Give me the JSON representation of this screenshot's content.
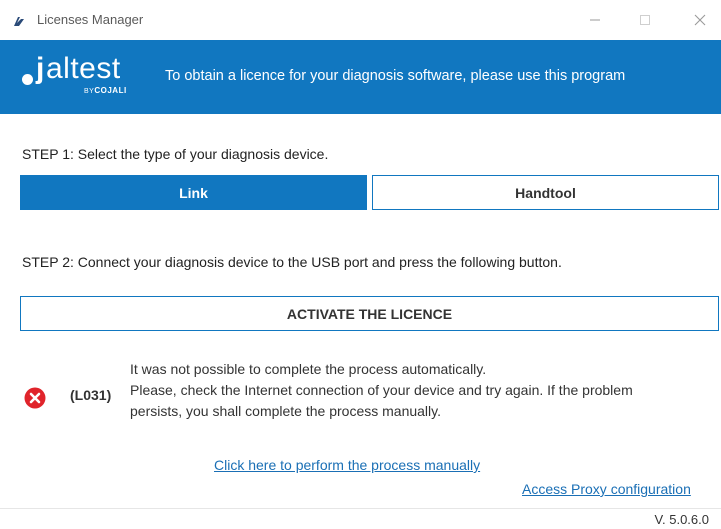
{
  "window": {
    "title": "Licenses Manager",
    "controls": {
      "minimize_icon": "minimize-icon",
      "maximize_icon": "maximize-icon",
      "close_icon": "close-icon"
    }
  },
  "banner": {
    "logo_text_j": "j",
    "logo_text_altest": "altest",
    "logo_by": "BY",
    "logo_brand": "COJALI",
    "message": "To obtain a licence for your diagnosis software, please use this program",
    "background_color": "#1177c0"
  },
  "step1": {
    "label": "STEP 1: Select the type of your diagnosis device.",
    "options": [
      {
        "label": "Link",
        "selected": true
      },
      {
        "label": "Handtool",
        "selected": false
      }
    ]
  },
  "step2": {
    "label": "STEP 2: Connect your diagnosis device to the USB port and press the following button.",
    "button_label": "ACTIVATE THE LICENCE"
  },
  "error": {
    "icon": "error-x-icon",
    "code": "(L031)",
    "lines": [
      "It was not possible to complete the process automatically.",
      "Please, check the Internet connection of your device and try again. If the problem",
      "persists, you shall complete the process manually."
    ],
    "color": "#e0242b"
  },
  "links": {
    "manual": "Click here to perform the process manually",
    "proxy": "Access Proxy configuration"
  },
  "footer": {
    "version": "V. 5.0.6.0"
  }
}
